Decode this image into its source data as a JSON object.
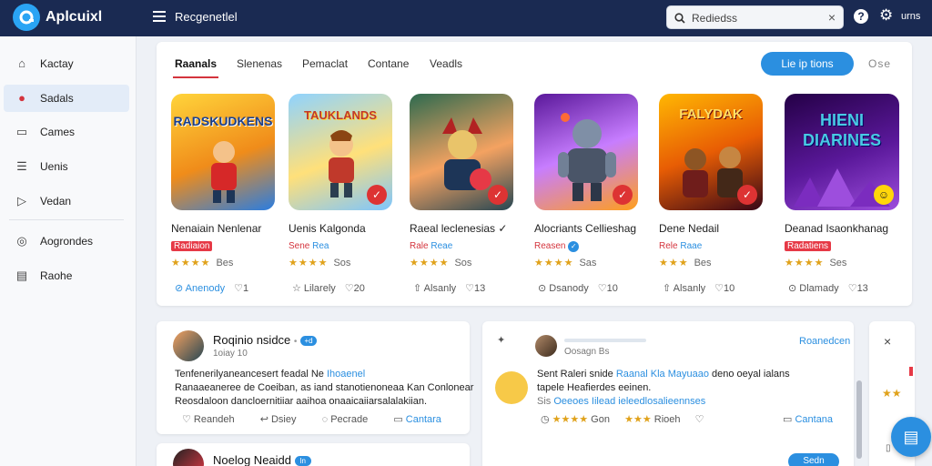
{
  "header": {
    "app_name": "Aplcuixl",
    "page_heading": "Recgenetlel",
    "search_value": "Rediedss",
    "user_label": "urns"
  },
  "sidebar": {
    "items": [
      {
        "label": "Kactay",
        "icon": "home-icon"
      },
      {
        "label": "Sadals",
        "icon": "fire-icon"
      },
      {
        "label": "Cames",
        "icon": "gamepad-icon"
      },
      {
        "label": "Uenis",
        "icon": "list-icon"
      },
      {
        "label": "Vedan",
        "icon": "video-icon"
      },
      {
        "label": "Aogrondes",
        "icon": "globe-icon"
      },
      {
        "label": "Raohe",
        "icon": "document-icon"
      }
    ]
  },
  "games_panel": {
    "tabs": [
      "Raanals",
      "Slenenas",
      "Pemaclat",
      "Contane",
      "Veadls"
    ],
    "primary_button": "Lie ip tions",
    "more_label": "Ose",
    "cards": [
      {
        "art": "RADSKUDKENS",
        "title": "Nenaiain Nenlenar",
        "tag_left": "Radiaion",
        "tag_right": "",
        "verified": false,
        "stars": "★★★★",
        "rating_count": "Bes",
        "action_main": "Anenody",
        "action_count": "1"
      },
      {
        "art": "TAUKLANDS",
        "title": "Uenis Kalgonda",
        "tag_left": "Sene",
        "tag_right": "Rea",
        "verified": false,
        "stars": "★★★★",
        "rating_count": "Sos",
        "action_main": "Lilarely",
        "action_count": "20"
      },
      {
        "art": "",
        "title": "Raeal leclenesias",
        "tag_left": "Rale",
        "tag_right": "Reae",
        "verified": true,
        "stars": "★★★★",
        "rating_count": "Sos",
        "action_main": "Alsanly",
        "action_count": "13"
      },
      {
        "art": "",
        "title": "Alocriants Cellieshag",
        "tag_left": "Reasen",
        "tag_right": "",
        "verified": true,
        "stars": "★★★★",
        "rating_count": "Sas",
        "action_main": "Dsanody",
        "action_count": "10"
      },
      {
        "art": "FALYDAK",
        "title": "Dene Nedail",
        "tag_left": "Rele",
        "tag_right": "Raae",
        "verified": false,
        "stars": "★★★",
        "rating_count": "Bes",
        "action_main": "Alsanly",
        "action_count": "10"
      },
      {
        "art": "HIENI DIARINES",
        "title": "Deanad Isaonkhanag",
        "tag_left": "Radatiens",
        "tag_right": "",
        "verified": false,
        "stars": "★★★★",
        "rating_count": "Ses",
        "action_main": "Dlamady",
        "action_count": "13"
      }
    ]
  },
  "post_left": {
    "name": "Roqinio nsidce",
    "meta": "1oiay 10",
    "verified_label": "+d",
    "body1_a": "Tenfenerilyaneancesert feadal Ne",
    "body1_link": "Ihoaenel",
    "body2": "Ranaaeaneree de Coeiban, as iand stanotienoneaa Kan Conlonear",
    "body3": "Reosdaloon dancloernitiiar aaihoa onaaicaiiarsalalakiian.",
    "actions": [
      "Reandeh",
      "Dsiey",
      "Pecrade",
      "Cantara"
    ]
  },
  "post_left2": {
    "name": "Noelog Neaidd",
    "verified_label": "In"
  },
  "post_mid": {
    "meta": "Oosagn Bs",
    "link_label": "Roanedcen",
    "body1": "Sent Raleri snide",
    "body1_link": "Raanal Kla Mayuaao",
    "body1_end": "deno oeyal ialans",
    "body2": "tapele Heafierdes eeinen.",
    "body3_link": "Oeeoes Iilead ieleedlosalieennses",
    "rating_a": "Gon",
    "rating_b": "Rioeh",
    "action_right": "Cantana",
    "button": "Sedn"
  }
}
